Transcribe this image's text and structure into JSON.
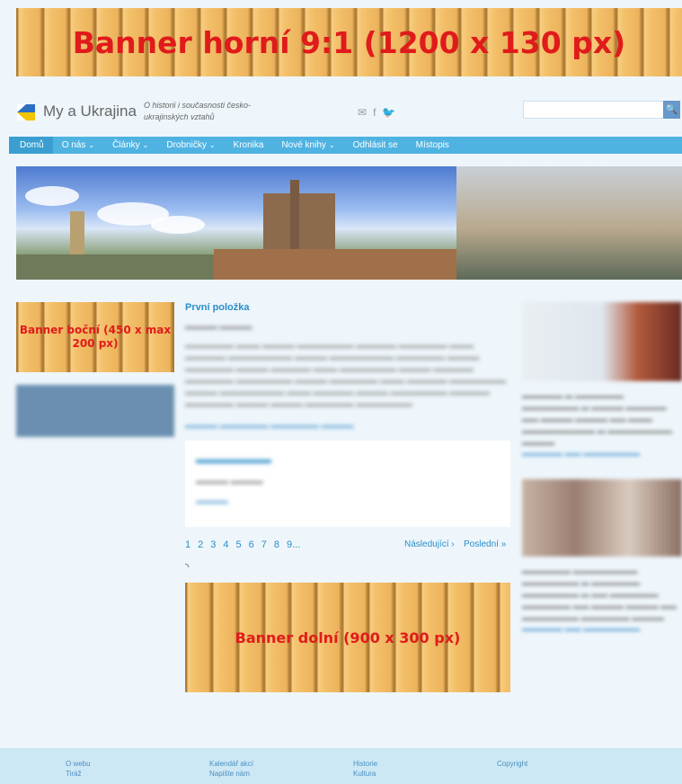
{
  "banners": {
    "top": "Banner horní 9:1 (1200 x 130 px)",
    "side": "Banner boční (450 x max 200 px)",
    "bottom": "Banner dolní (900 x 300 px)"
  },
  "header": {
    "site_title": "My a Ukrajina",
    "tagline": "O historii i současnosti česko-ukrajinských vztahů",
    "search_placeholder": "",
    "search_button": "🔍"
  },
  "nav": {
    "items": [
      {
        "label": "Domů",
        "chevron": ""
      },
      {
        "label": "O nás",
        "chevron": "⌄"
      },
      {
        "label": "Články",
        "chevron": "⌄"
      },
      {
        "label": "Drobničky",
        "chevron": "⌄"
      },
      {
        "label": "Kronika",
        "chevron": ""
      },
      {
        "label": "Nové knihy",
        "chevron": "⌄"
      },
      {
        "label": "Odhlásit se",
        "chevron": ""
      },
      {
        "label": "Místopis",
        "chevron": ""
      }
    ]
  },
  "main": {
    "post_title": "První položka",
    "pagination": {
      "pages": [
        "1",
        "2",
        "3",
        "4",
        "5",
        "6",
        "7",
        "8",
        "9..."
      ],
      "next": "Následující ›",
      "last": "Poslední »"
    }
  },
  "footer": {
    "col1": [
      "O webu",
      "Tiráž"
    ],
    "col2": [
      "Kalendář akcí",
      "Napište nám"
    ],
    "col3": [
      "Historie",
      "Kultura"
    ],
    "col4": [
      "Copyright"
    ]
  },
  "colors": {
    "nav_bg": "#4fb3e2",
    "link": "#2a8ec8",
    "banner_text": "#e01b1b",
    "footer_bg": "#cde8f5"
  }
}
